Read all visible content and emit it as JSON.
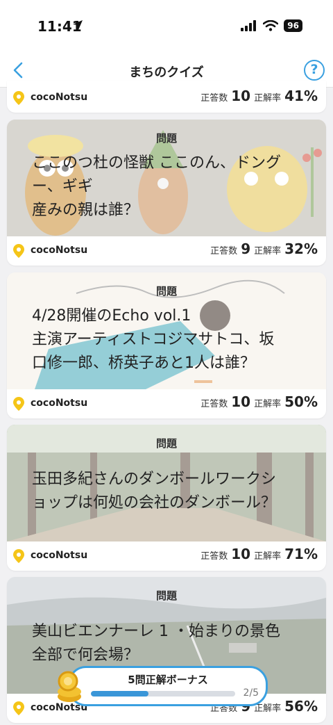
{
  "status": {
    "time": "11:41",
    "battery": "96"
  },
  "nav": {
    "title": "まちのクイズ",
    "help": "?"
  },
  "cards": [
    {
      "author": "cocoNotsu",
      "answers_label": "正答数",
      "answers": "10",
      "rate_label": "正解率",
      "rate": "41%"
    },
    {
      "label": "問題",
      "question": "ここのつ杜の怪獣 ここのん、ドング ー、ギギ\n産みの親は誰？",
      "author": "cocoNotsu",
      "answers_label": "正答数",
      "answers": "9",
      "rate_label": "正解率",
      "rate": "32%"
    },
    {
      "label": "問題",
      "question": "4/28開催のEcho vol.1\n主演アーティストコジマサトコ、坂口修一郎、桥英子あと1人は誰？",
      "author": "cocoNotsu",
      "answers_label": "正答数",
      "answers": "10",
      "rate_label": "正解率",
      "rate": "50%"
    },
    {
      "label": "問題",
      "question": "玉田多紀さんのダンボールワークショップは何処の会社のダンボール？",
      "author": "cocoNotsu",
      "answers_label": "正答数",
      "answers": "10",
      "rate_label": "正解率",
      "rate": "71%"
    },
    {
      "label": "問題",
      "question": "美山ビエンナーレ 1 ・始まりの景色全部で何会場？",
      "author": "cocoNotsu",
      "answers_label": "正答数",
      "answers": "9",
      "rate_label": "正解率",
      "rate": "56%"
    }
  ],
  "bonus": {
    "title": "5問正解ボーナス",
    "count": "2/5",
    "progress": 0.4
  },
  "colors": {
    "accent": "#3aa0e0",
    "pin": "#f5c518"
  }
}
